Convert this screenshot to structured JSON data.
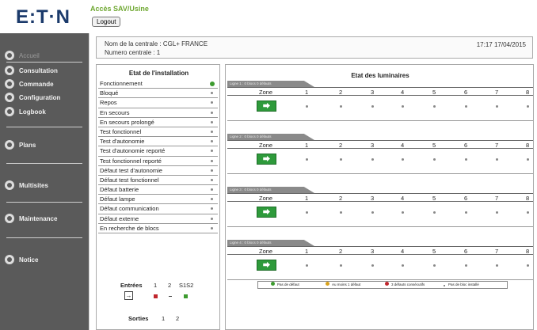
{
  "header": {
    "logo": "E:T·N",
    "app_title": "Accès SAV/Usine",
    "logout_label": "Logout"
  },
  "sidebar": {
    "items": [
      {
        "label": "Accueil",
        "icon": "home-icon"
      },
      {
        "label": "Consultation",
        "icon": "consultation-icon"
      },
      {
        "label": "Commande",
        "icon": "command-icon"
      },
      {
        "label": "Configuration",
        "icon": "gear-icon"
      },
      {
        "label": "Logbook",
        "icon": "logbook-icon"
      },
      {
        "label": "Plans",
        "icon": "plans-icon"
      },
      {
        "label": "Multisites",
        "icon": "multisites-icon"
      },
      {
        "label": "Maintenance",
        "icon": "wrench-icon"
      },
      {
        "label": "Notice",
        "icon": "notice-icon"
      }
    ]
  },
  "info": {
    "central_name": "Nom de la centrale : CGL+ FRANCE",
    "central_number": "Numero centrale : 1",
    "clock": "17:17 17/04/2015"
  },
  "installation": {
    "title": "Etat de l'installation",
    "statuses": [
      "Fonctionnement",
      "Bloqué",
      "Repos",
      "En secours",
      "En secours prolongé",
      "Test fonctionnel",
      "Test d'autonomie",
      "Test d'autonomie reporté",
      "Test fonctionnel reporté",
      "Défaut test d'autonomie",
      "Défaut test fonctionnel",
      "Défaut batterie",
      "Défaut lampe",
      "Défaut communication",
      "Défaut externe",
      "En recherche de blocs"
    ],
    "entrees_label": "Entrées",
    "entrees_cols": [
      "1",
      "2",
      "S1S2"
    ],
    "sorties_label": "Sorties",
    "sorties_cols": [
      "1",
      "2"
    ]
  },
  "luminaires": {
    "title": "Etat des luminaires",
    "zone_label": "Zone",
    "columns": [
      "1",
      "2",
      "3",
      "4",
      "5",
      "6",
      "7",
      "8"
    ],
    "lines": [
      {
        "tab": "Ligne 1 : 0 blocs 0 défauts"
      },
      {
        "tab": "Ligne 2 : 0 blocs 0 défauts"
      },
      {
        "tab": "Ligne 3 : 0 blocs 0 défauts"
      },
      {
        "tab": "Ligne 4 : 0 blocs 0 défauts"
      }
    ],
    "exit_sign_glyph": "⮕",
    "legend": {
      "no_fault": "Pas de défaut",
      "one_fault": "Au moins 1 défaut",
      "three_faults": "3 défauts consécutifs",
      "no_block": "Pas de bloc installé"
    }
  },
  "colors": {
    "sidebar_bg": "#5a5a5a",
    "accent_green": "#6fa832",
    "ok": "#3d9b2f",
    "warn": "#d9a21c",
    "error": "#c0262d",
    "exit_green": "#2e9a3b"
  }
}
